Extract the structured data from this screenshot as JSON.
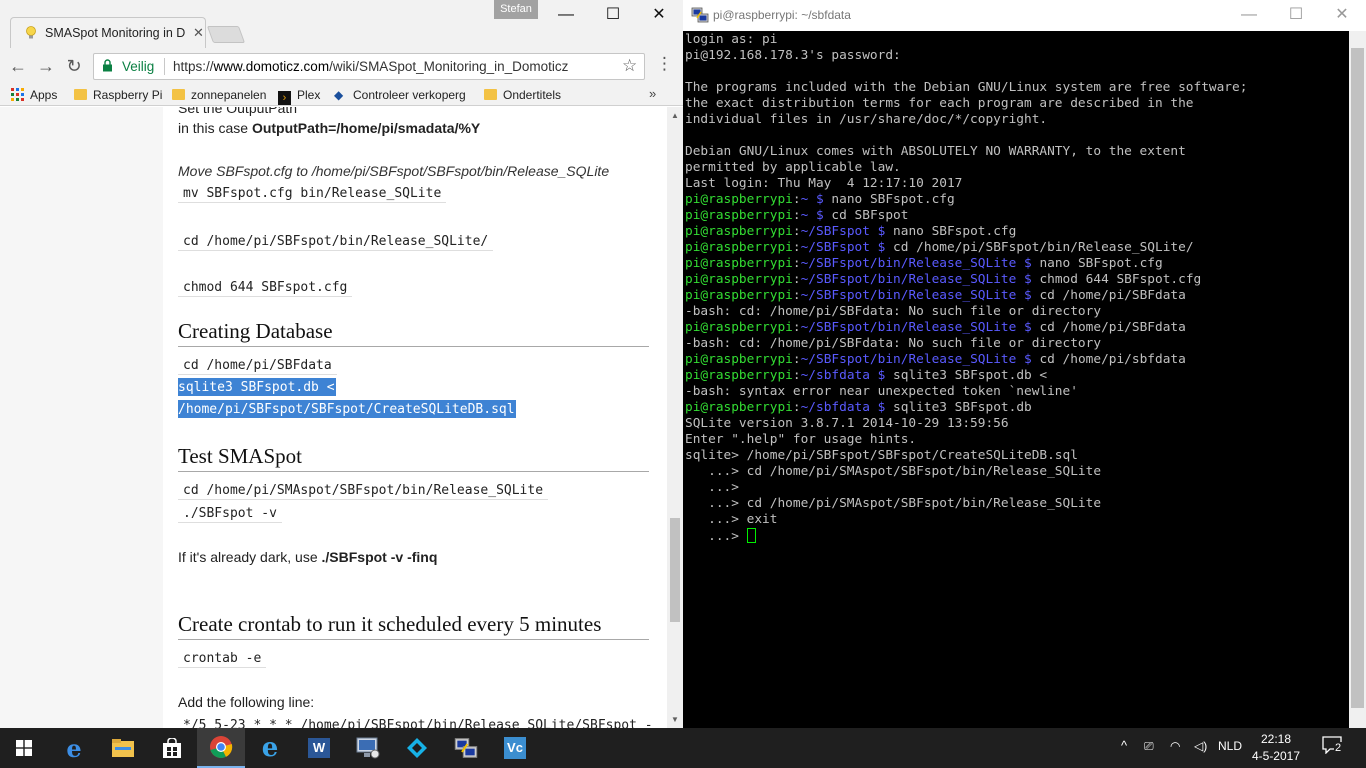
{
  "chrome": {
    "tab_title": "SMASpot Monitoring in D",
    "profile_name": "Stefan",
    "secure_label": "Veilig",
    "url_scheme": "https://",
    "url_host": "www.domoticz.com",
    "url_path": "/wiki/SMASpot_Monitoring_in_Domoticz",
    "bookmarks": [
      "Apps",
      "Raspberry Pi",
      "zonnepanelen",
      "Plex",
      "Controleer verkoperg",
      "Ondertitels"
    ]
  },
  "page": {
    "top_fragment": "Set the OutputPath",
    "output_line_prefix": "in this case ",
    "output_line_bold": "OutputPath=/home/pi/smadata/%Y",
    "move_note": "Move SBFspot.cfg to /home/pi/SBFspot/SBFspot/bin/Release_SQLite",
    "code_mv": "mv SBFspot.cfg bin/Release_SQLite",
    "code_cd_release": "cd /home/pi/SBFspot/bin/Release_SQLite/",
    "code_chmod": "chmod 644 SBFspot.cfg",
    "heading_db": "Creating Database",
    "code_cd_data": "cd /home/pi/SBFdata",
    "code_sqlite_1": "sqlite3 SBFspot.db <",
    "code_sqlite_2": "/home/pi/SBFspot/SBFspot/CreateSQLiteDB.sql",
    "heading_test": "Test SMASpot",
    "code_cd_sma": "cd /home/pi/SMAspot/SBFspot/bin/Release_SQLite",
    "code_run": "./SBFspot -v",
    "dark_prefix": "If it's already dark, use ",
    "dark_bold": "./SBFspot -v -finq",
    "heading_cron": "Create crontab to run it scheduled every 5 minutes",
    "code_crontab": "crontab -e",
    "add_line": "Add the following line:",
    "code_cron_line": "*/5 5-23 * * * /home/pi/SBFspot/bin/Release_SQLite/SBFspot -"
  },
  "putty": {
    "title": "pi@raspberrypi: ~/sbfdata",
    "lines": [
      {
        "t": "login as: pi"
      },
      {
        "t": "pi@192.168.178.3's password:"
      },
      {
        "t": ""
      },
      {
        "t": "The programs included with the Debian GNU/Linux system are free software;"
      },
      {
        "t": "the exact distribution terms for each program are described in the"
      },
      {
        "t": "individual files in /usr/share/doc/*/copyright."
      },
      {
        "t": ""
      },
      {
        "t": "Debian GNU/Linux comes with ABSOLUTELY NO WARRANTY, to the extent"
      },
      {
        "t": "permitted by applicable law."
      },
      {
        "t": "Last login: Thu May  4 12:17:10 2017"
      },
      {
        "u": "pi@raspberrypi",
        "p": "~",
        "c": "nano SBFspot.cfg"
      },
      {
        "u": "pi@raspberrypi",
        "p": "~",
        "c": "cd SBFspot"
      },
      {
        "u": "pi@raspberrypi",
        "p": "~/SBFspot",
        "c": "nano SBFspot.cfg"
      },
      {
        "u": "pi@raspberrypi",
        "p": "~/SBFspot",
        "c": "cd /home/pi/SBFspot/bin/Release_SQLite/"
      },
      {
        "u": "pi@raspberrypi",
        "p": "~/SBFspot/bin/Release_SQLite",
        "c": "nano SBFspot.cfg"
      },
      {
        "u": "pi@raspberrypi",
        "p": "~/SBFspot/bin/Release_SQLite",
        "c": "chmod 644 SBFspot.cfg"
      },
      {
        "u": "pi@raspberrypi",
        "p": "~/SBFspot/bin/Release_SQLite",
        "c": "cd /home/pi/SBFdata"
      },
      {
        "t": "-bash: cd: /home/pi/SBFdata: No such file or directory"
      },
      {
        "u": "pi@raspberrypi",
        "p": "~/SBFspot/bin/Release_SQLite",
        "c": "cd /home/pi/SBFdata"
      },
      {
        "t": "-bash: cd: /home/pi/SBFdata: No such file or directory"
      },
      {
        "u": "pi@raspberrypi",
        "p": "~/SBFspot/bin/Release_SQLite",
        "c": "cd /home/pi/sbfdata"
      },
      {
        "u": "pi@raspberrypi",
        "p": "~/sbfdata",
        "c": "sqlite3 SBFspot.db <"
      },
      {
        "t": "-bash: syntax error near unexpected token `newline'"
      },
      {
        "u": "pi@raspberrypi",
        "p": "~/sbfdata",
        "c": "sqlite3 SBFspot.db"
      },
      {
        "t": "SQLite version 3.8.7.1 2014-10-29 13:59:56"
      },
      {
        "t": "Enter \".help\" for usage hints."
      },
      {
        "t": "sqlite> /home/pi/SBFspot/SBFspot/CreateSQLiteDB.sql"
      },
      {
        "t": "   ...> cd /home/pi/SMAspot/SBFspot/bin/Release_SQLite"
      },
      {
        "t": "   ...>"
      },
      {
        "t": "   ...> cd /home/pi/SMAspot/SBFspot/bin/Release_SQLite"
      },
      {
        "t": "   ...> exit"
      },
      {
        "t": "   ...> ",
        "cursor": true
      }
    ]
  },
  "taskbar": {
    "language": "NLD",
    "time": "22:18",
    "date": "4-5-2017",
    "notification_count": "2",
    "apps": [
      "windows-start-icon",
      "edge-icon",
      "file-explorer-icon",
      "store-icon",
      "chrome-icon",
      "internet-explorer-icon",
      "word-icon",
      "remote-desktop-icon",
      "kodi-icon",
      "putty-icon",
      "vnc-icon"
    ]
  },
  "colors": {
    "prompt_user": "#33dd33",
    "prompt_path": "#5a5aff",
    "selection": "#3e83d4",
    "secure": "#0b8043"
  }
}
